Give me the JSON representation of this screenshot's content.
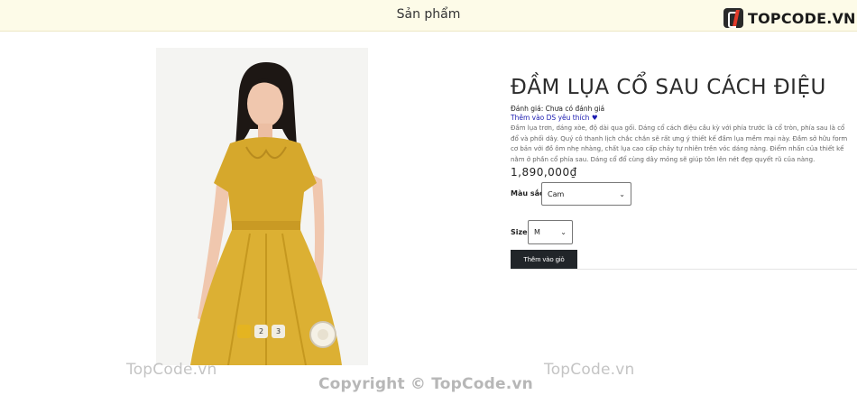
{
  "header": {
    "title": "Sản phẩm"
  },
  "brand": {
    "name": "TOPCODE.VN"
  },
  "product": {
    "name": "ĐẦM LỤA CỔ SAU CÁCH ĐIỆU",
    "rating_text": "Đánh giá: Chưa có đánh giá",
    "wishlist_text": "Thêm vào DS yêu thích",
    "description": "Đầm lụa trơn, dáng xòe, độ dài qua gối. Dáng cổ cách điệu cầu kỳ với phía trước là cổ tròn, phía sau là cổ đổ và phối dây. Quý cô thanh lịch chắc chắn sẽ rất ưng ý thiết kế đầm lụa mềm mại này. Đầm sở hữu form cơ bản với đồ ôm nhẹ nhàng, chất lụa cao cấp chảy tự nhiên trên vóc dáng nàng. Điểm nhấn của thiết kế nằm ở phần cổ phía sau. Dáng cổ đổ cùng dây mỏng sẽ giúp tôn lên nét đẹp quyết rũ của nàng.",
    "price": "1,890,000₫",
    "color_label": "Màu sắc:",
    "color_value": "Cam",
    "size_label": "Size:",
    "size_value": "M",
    "add_to_cart": "Thêm vào giỏ",
    "dress_color": "#d6a82c"
  },
  "gallery": {
    "pages": [
      "1",
      "2",
      "3"
    ],
    "active": 1
  },
  "watermarks": {
    "left": "TopCode.vn",
    "right": "TopCode.vn",
    "center": "Copyright © TopCode.vn"
  }
}
